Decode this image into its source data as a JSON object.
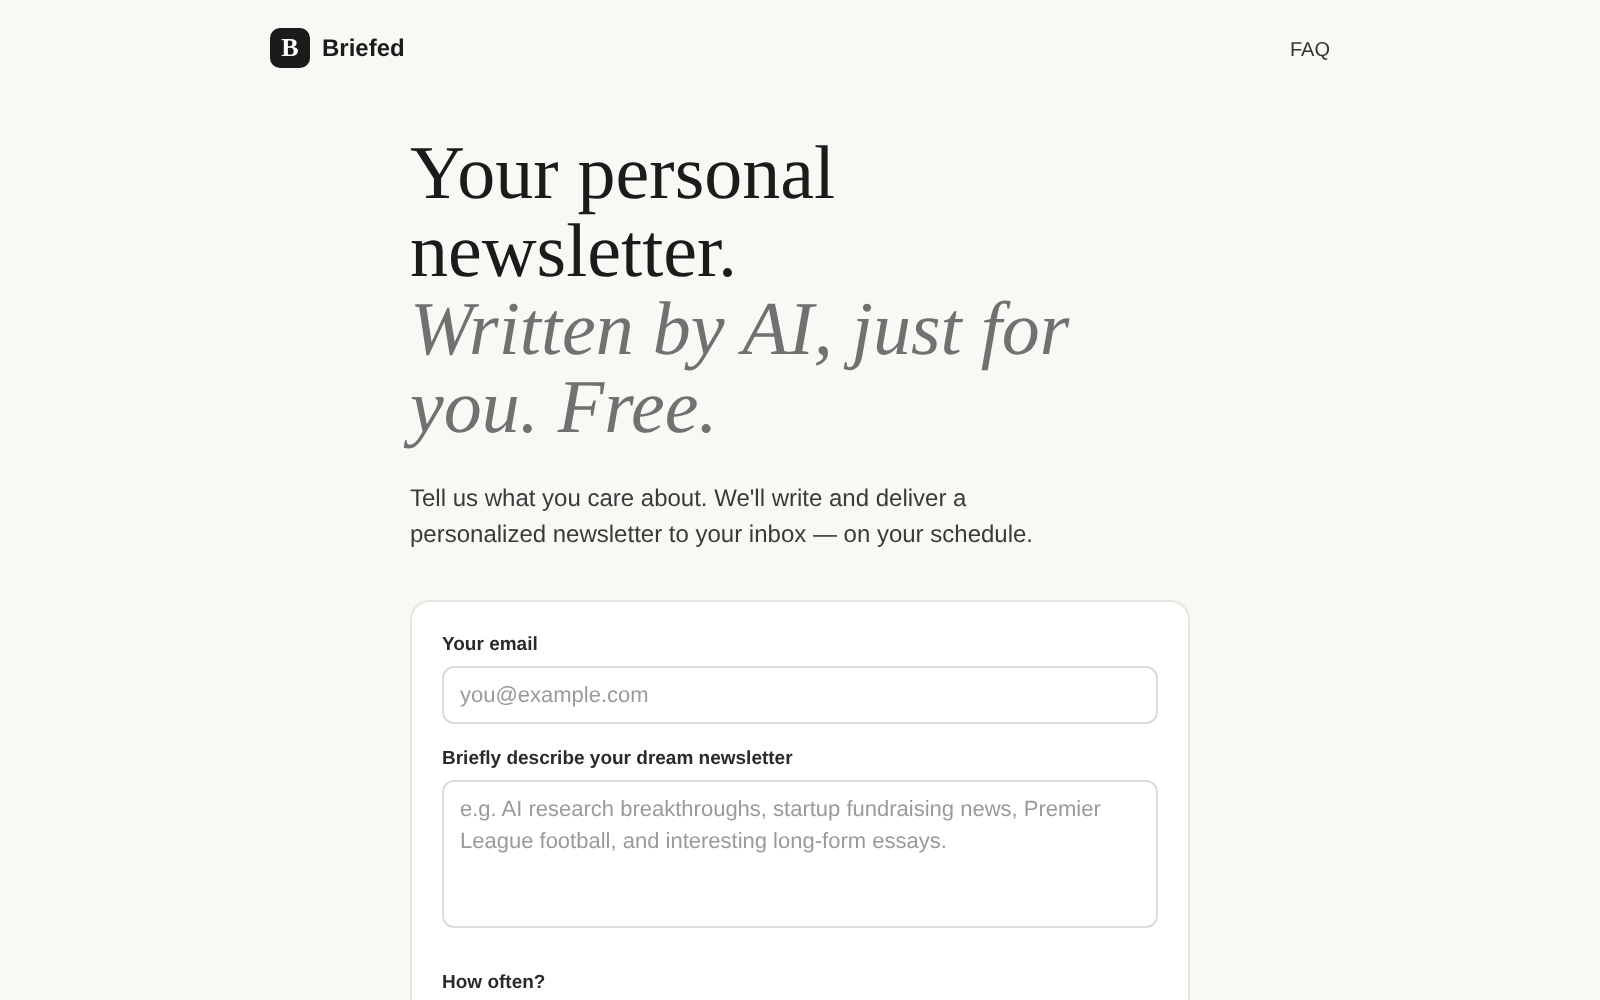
{
  "header": {
    "logo_letter": "B",
    "brand": "Briefed",
    "nav": [
      "FAQ"
    ]
  },
  "hero": {
    "title": "Your personal newsletter.",
    "tagline": "Written by AI, just for you. Free.",
    "description": "Tell us what you care about. We'll write and deliver a personalized newsletter to your inbox — on your schedule."
  },
  "form": {
    "fields": [
      {
        "kind": "input",
        "label": "Your email",
        "placeholder": "you@example.com"
      },
      {
        "kind": "textarea",
        "label": "Briefly describe your dream newsletter",
        "placeholder": "e.g. AI research breakthroughs, startup fundraising news, Premier League football, and interesting long-form essays."
      },
      {
        "kind": "heading",
        "label": "How often?"
      }
    ]
  }
}
